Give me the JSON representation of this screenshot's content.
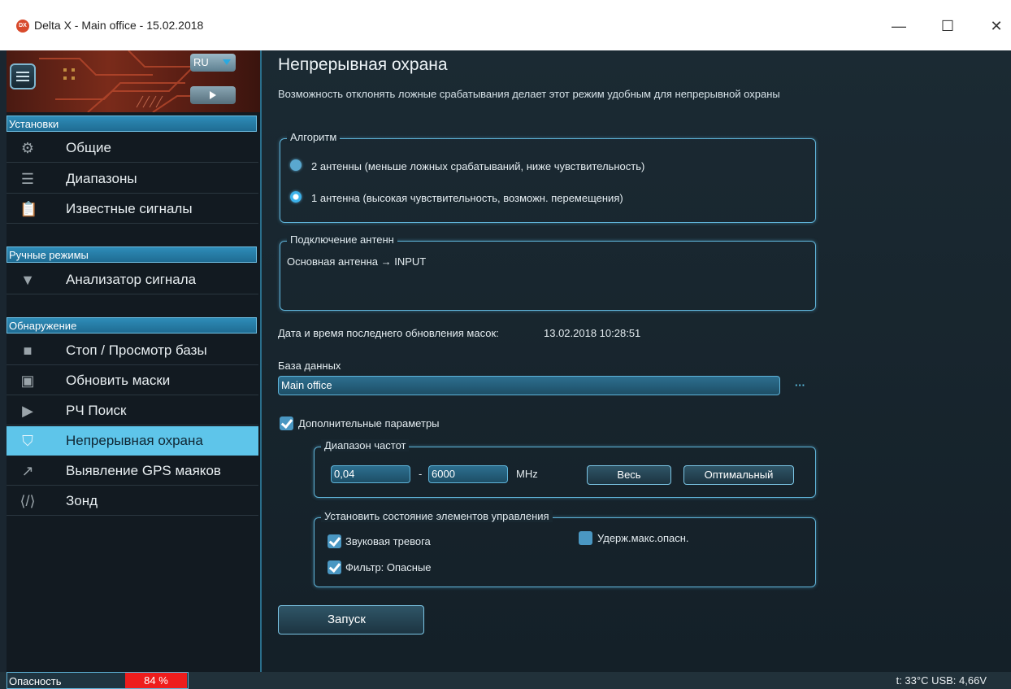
{
  "window": {
    "app_icon_text": "DX",
    "title": "Delta X - Main office - 15.02.2018",
    "minimize": "—",
    "maximize": "☐",
    "close": "✕"
  },
  "sidebar": {
    "language": "RU",
    "sections": [
      {
        "header": "Установки",
        "items": [
          {
            "icon": "gear-icon",
            "label": "Общие"
          },
          {
            "icon": "list-icon",
            "label": "Диапазоны"
          },
          {
            "icon": "clipboard-icon",
            "label": "Известные сигналы"
          }
        ]
      },
      {
        "header": "Ручные режимы",
        "items": [
          {
            "icon": "signal-icon",
            "label": "Анализатор сигнала"
          }
        ]
      },
      {
        "header": "Обнаружение",
        "items": [
          {
            "icon": "stop-icon",
            "label": "Стоп / Просмотр базы"
          },
          {
            "icon": "image-icon",
            "label": "Обновить маски"
          },
          {
            "icon": "play-icon",
            "label": "РЧ Поиск"
          },
          {
            "icon": "shield-icon",
            "label": "Непрерывная охрана",
            "active": true
          },
          {
            "icon": "trend-icon",
            "label": "Выявление GPS маяков"
          },
          {
            "icon": "code-icon",
            "label": "Зонд"
          }
        ]
      }
    ]
  },
  "main": {
    "title": "Непрерывная охрана",
    "subtitle": "Возможность отклонять ложные срабатывания делает этот режим удобным для непрерывной охраны",
    "algorithm": {
      "legend": "Алгоритм",
      "options": [
        {
          "label": "2 антенны (меньше ложных срабатываний, ниже чувствительность)",
          "checked": false
        },
        {
          "label": "1 антенна (высокая чувствительность, возможн. перемещения)",
          "checked": true
        }
      ]
    },
    "antenna": {
      "legend": "Подключение антенн",
      "text": "Основная антенна → INPUT"
    },
    "masks_update": {
      "label": "Дата и время последнего обновления масок:",
      "value": "13.02.2018 10:28:51"
    },
    "database": {
      "label": "База данных",
      "value": "Main office",
      "browse": "···"
    },
    "extra_params": {
      "label": "Дополнительные параметры",
      "checked": true
    },
    "freq_range": {
      "legend": "Диапазон частот",
      "from": "0,04",
      "dash": "-",
      "to": "6000",
      "unit": "MHz",
      "all_button": "Весь",
      "optimal_button": "Оптимальный"
    },
    "controls": {
      "legend": "Установить состояние элементов управления",
      "sound_alarm": {
        "label": "Звуковая тревога",
        "checked": true
      },
      "hold_max": {
        "label": "Удерж.макс.опасн.",
        "checked": false
      },
      "filter": {
        "label": "Фильтр: Опасные",
        "checked": true
      }
    },
    "start_button": "Запуск"
  },
  "status": {
    "danger_label": "Опасность",
    "danger_value": "84 %",
    "device": "t: 33°C  USB: 4,66V"
  },
  "colors": {
    "accent": "#5ec5ea",
    "danger": "#ee1d1d"
  }
}
